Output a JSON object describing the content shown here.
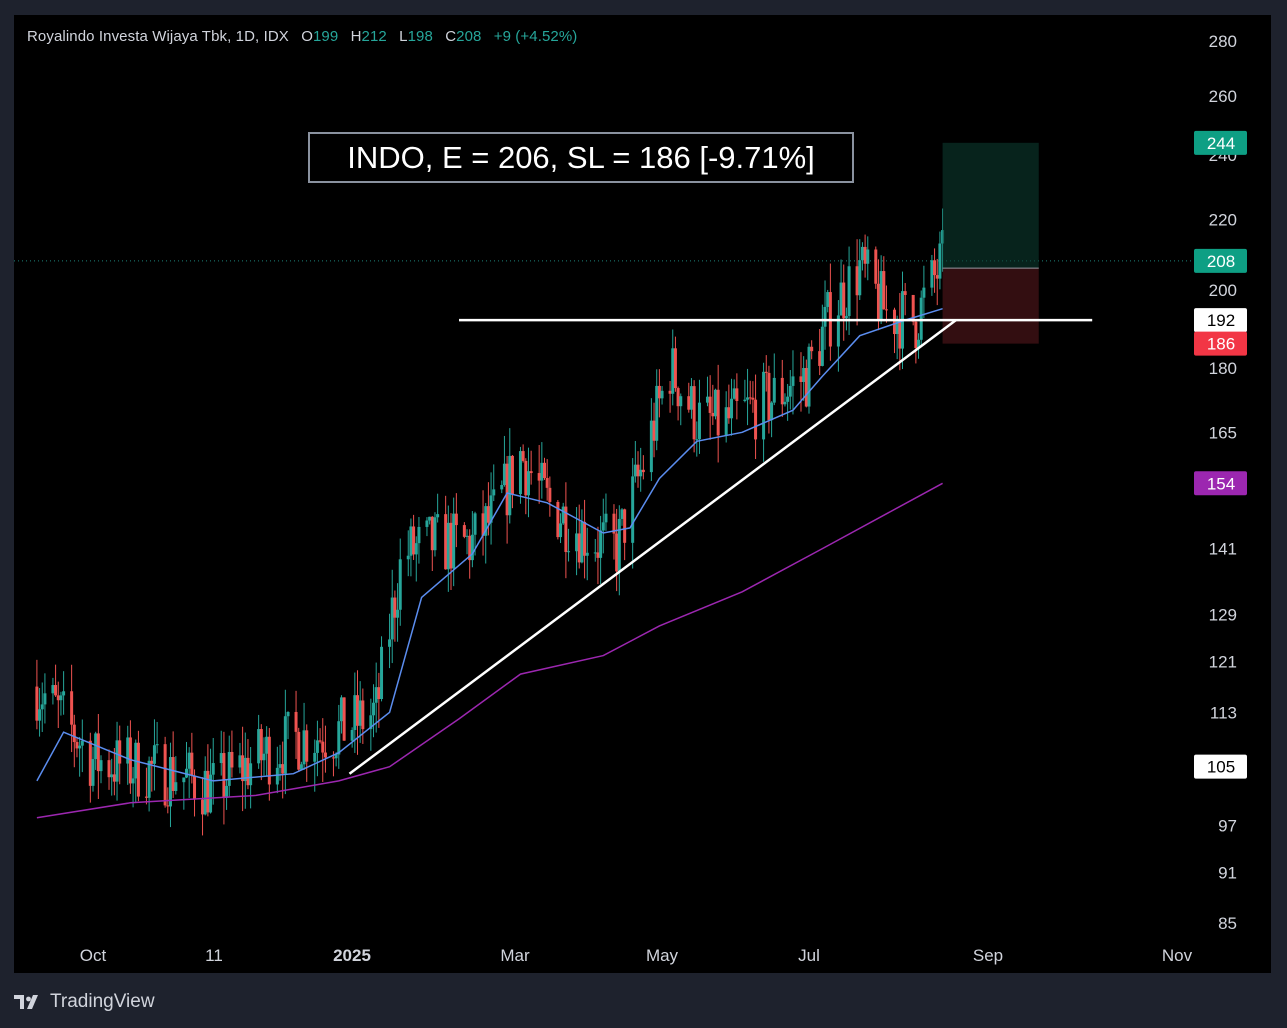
{
  "chart_data": {
    "type": "candlestick",
    "symbol": "Royalindo Investa Wijaya Tbk",
    "interval": "1D",
    "exchange": "IDX",
    "ohlc": {
      "open": "199",
      "high": "212",
      "low": "198",
      "close": "208",
      "change": "+9 (+4.52%)"
    },
    "annotation": "INDO, E = 206, SL = 186 [-9.71%]",
    "x_labels": [
      "Oct",
      "11",
      "2025",
      "Mar",
      "May",
      "Jul",
      "Sep",
      "Nov"
    ],
    "y_ticks": [
      280,
      260,
      240,
      220,
      200,
      180,
      165,
      141,
      129,
      121,
      113,
      97,
      91,
      85
    ],
    "y_scale": "log",
    "price_tags": [
      {
        "label": "244",
        "value": 244,
        "color": "#0e9f84",
        "text_color": "#ffffff"
      },
      {
        "label": "208",
        "value": 208,
        "color": "#0e9f84",
        "text_color": "#ffffff"
      },
      {
        "label": "192",
        "value": 192,
        "color": "#ffffff",
        "text_color": "#000000"
      },
      {
        "label": "186",
        "value": 186,
        "color": "#f23645",
        "text_color": "#ffffff"
      },
      {
        "label": "154",
        "value": 154,
        "color": "#9c27b0",
        "text_color": "#ffffff"
      },
      {
        "label": "105",
        "value": 105,
        "color": "#ffffff",
        "text_color": "#000000"
      }
    ],
    "close_series": [
      {
        "date": "2024-09-10",
        "close": 117
      },
      {
        "date": "2024-09-20",
        "close": 112
      },
      {
        "date": "2024-10-01",
        "close": 106
      },
      {
        "date": "2024-10-15",
        "close": 105
      },
      {
        "date": "2024-11-01",
        "close": 104
      },
      {
        "date": "2024-11-15",
        "close": 102
      },
      {
        "date": "2024-12-01",
        "close": 106
      },
      {
        "date": "2024-12-15",
        "close": 109
      },
      {
        "date": "2024-12-31",
        "close": 110
      },
      {
        "date": "2025-01-15",
        "close": 113
      },
      {
        "date": "2025-01-25",
        "close": 140
      },
      {
        "date": "2025-02-05",
        "close": 142
      },
      {
        "date": "2025-02-20",
        "close": 142
      },
      {
        "date": "2025-03-01",
        "close": 148
      },
      {
        "date": "2025-03-10",
        "close": 160
      },
      {
        "date": "2025-03-20",
        "close": 150
      },
      {
        "date": "2025-04-05",
        "close": 143
      },
      {
        "date": "2025-04-15",
        "close": 141
      },
      {
        "date": "2025-04-25",
        "close": 158
      },
      {
        "date": "2025-05-05",
        "close": 180
      },
      {
        "date": "2025-05-15",
        "close": 168
      },
      {
        "date": "2025-05-25",
        "close": 167
      },
      {
        "date": "2025-06-10",
        "close": 172
      },
      {
        "date": "2025-06-25",
        "close": 178
      },
      {
        "date": "2025-07-05",
        "close": 195
      },
      {
        "date": "2025-07-15",
        "close": 206
      },
      {
        "date": "2025-07-25",
        "close": 194
      },
      {
        "date": "2025-08-05",
        "close": 192
      },
      {
        "date": "2025-08-15",
        "close": 208
      }
    ],
    "ema_fast": [
      {
        "date": "2024-09-10",
        "value": 103
      },
      {
        "date": "2024-09-20",
        "value": 110
      },
      {
        "date": "2024-10-15",
        "value": 106
      },
      {
        "date": "2024-11-15",
        "value": 103
      },
      {
        "date": "2024-12-15",
        "value": 104
      },
      {
        "date": "2025-01-01",
        "value": 107
      },
      {
        "date": "2025-01-20",
        "value": 113
      },
      {
        "date": "2025-02-01",
        "value": 132
      },
      {
        "date": "2025-02-20",
        "value": 140
      },
      {
        "date": "2025-03-05",
        "value": 152
      },
      {
        "date": "2025-03-20",
        "value": 150
      },
      {
        "date": "2025-04-10",
        "value": 144
      },
      {
        "date": "2025-04-20",
        "value": 145
      },
      {
        "date": "2025-05-01",
        "value": 155
      },
      {
        "date": "2025-05-15",
        "value": 163
      },
      {
        "date": "2025-06-01",
        "value": 165
      },
      {
        "date": "2025-06-20",
        "value": 170
      },
      {
        "date": "2025-07-01",
        "value": 178
      },
      {
        "date": "2025-07-15",
        "value": 188
      },
      {
        "date": "2025-08-01",
        "value": 192
      },
      {
        "date": "2025-08-15",
        "value": 195
      }
    ],
    "ema_slow": [
      {
        "date": "2024-09-10",
        "value": 98
      },
      {
        "date": "2024-10-15",
        "value": 100
      },
      {
        "date": "2024-12-01",
        "value": 101
      },
      {
        "date": "2025-01-01",
        "value": 103
      },
      {
        "date": "2025-01-20",
        "value": 105
      },
      {
        "date": "2025-02-15",
        "value": 112
      },
      {
        "date": "2025-03-10",
        "value": 119
      },
      {
        "date": "2025-04-10",
        "value": 122
      },
      {
        "date": "2025-05-01",
        "value": 127
      },
      {
        "date": "2025-06-01",
        "value": 133
      },
      {
        "date": "2025-07-01",
        "value": 141
      },
      {
        "date": "2025-08-15",
        "value": 154
      }
    ],
    "horizontal_line": {
      "value": 192,
      "from": "2025-02-15",
      "to": "2025-10-10"
    },
    "trend_line": {
      "from": {
        "date": "2025-01-05",
        "value": 104
      },
      "to": {
        "date": "2025-08-20",
        "value": 192
      }
    },
    "position_tool": {
      "entry": 206,
      "target": 244,
      "stop": 186,
      "from": "2025-08-15",
      "to": "2025-09-20"
    },
    "colors": {
      "up": "#26a69a",
      "down": "#ef5350",
      "ema_fast": "#5b8def",
      "ema_slow": "#9c27b0",
      "background": "#000000"
    }
  },
  "footer": {
    "brand": "TradingView"
  }
}
